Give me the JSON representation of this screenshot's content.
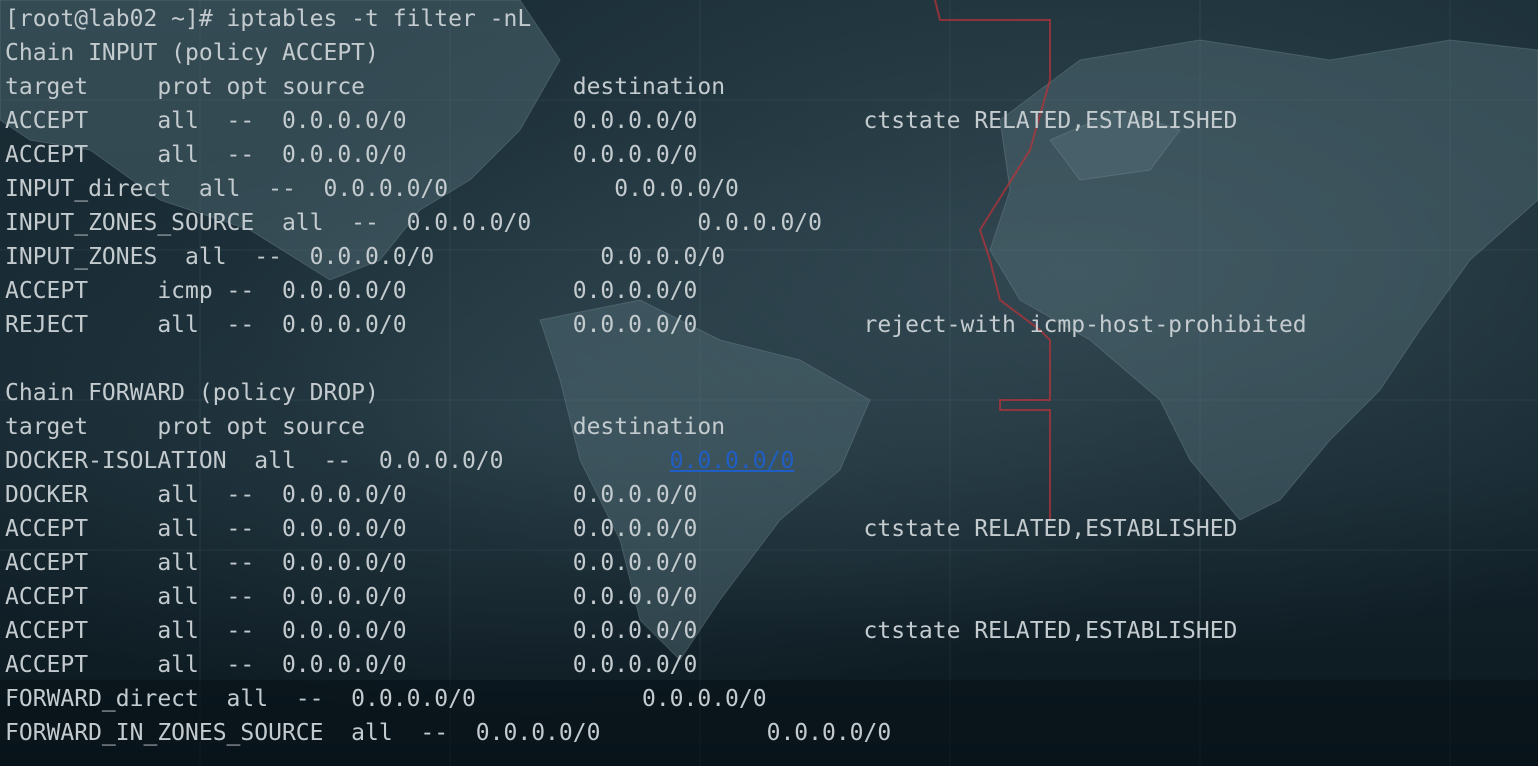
{
  "terminal": {
    "lines": [
      {
        "text": "[root@lab02 ~]# iptables -t filter -nL"
      },
      {
        "text": "Chain INPUT (policy ACCEPT)"
      },
      {
        "text": "target     prot opt source               destination"
      },
      {
        "text": "ACCEPT     all  --  0.0.0.0/0            0.0.0.0/0            ctstate RELATED,ESTABLISHED"
      },
      {
        "text": "ACCEPT     all  --  0.0.0.0/0            0.0.0.0/0"
      },
      {
        "text": "INPUT_direct  all  --  0.0.0.0/0            0.0.0.0/0"
      },
      {
        "text": "INPUT_ZONES_SOURCE  all  --  0.0.0.0/0            0.0.0.0/0"
      },
      {
        "text": "INPUT_ZONES  all  --  0.0.0.0/0            0.0.0.0/0"
      },
      {
        "text": "ACCEPT     icmp --  0.0.0.0/0            0.0.0.0/0"
      },
      {
        "text": "REJECT     all  --  0.0.0.0/0            0.0.0.0/0            reject-with icmp-host-prohibited"
      },
      {
        "text": ""
      },
      {
        "text": "Chain FORWARD (policy DROP)"
      },
      {
        "text": "target     prot opt source               destination"
      },
      {
        "text": "DOCKER-ISOLATION  all  --  0.0.0.0/0            ",
        "link": "0.0.0.0/0"
      },
      {
        "text": "DOCKER     all  --  0.0.0.0/0            0.0.0.0/0"
      },
      {
        "text": "ACCEPT     all  --  0.0.0.0/0            0.0.0.0/0            ctstate RELATED,ESTABLISHED"
      },
      {
        "text": "ACCEPT     all  --  0.0.0.0/0            0.0.0.0/0"
      },
      {
        "text": "ACCEPT     all  --  0.0.0.0/0            0.0.0.0/0"
      },
      {
        "text": "ACCEPT     all  --  0.0.0.0/0            0.0.0.0/0            ctstate RELATED,ESTABLISHED"
      },
      {
        "text": "ACCEPT     all  --  0.0.0.0/0            0.0.0.0/0"
      },
      {
        "text": "FORWARD_direct  all  --  0.0.0.0/0            0.0.0.0/0"
      },
      {
        "text": "FORWARD_IN_ZONES_SOURCE  all  --  0.0.0.0/0            0.0.0.0/0"
      }
    ]
  },
  "colors": {
    "text": "#c3cbcf",
    "link": "#1f5ec4",
    "background": "#15262f"
  },
  "icons": [
    "world-map-background"
  ]
}
